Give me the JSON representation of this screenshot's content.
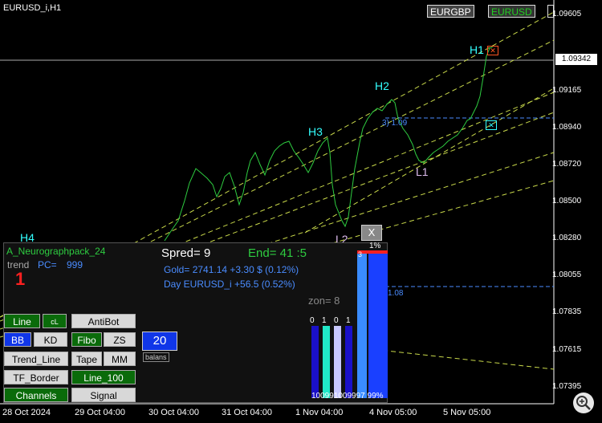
{
  "symbol_title": "EURUSD_i,H1",
  "symbol_tabs": [
    {
      "label": "EURGBP",
      "color": "#ffffff"
    },
    {
      "label": "EURUSD",
      "color": "#22cc22"
    }
  ],
  "price_axis": [
    "1.09605",
    "1.09165",
    "1.08940",
    "1.08720",
    "1.08500",
    "1.08280",
    "1.08055",
    "1.07835",
    "1.07615",
    "1.07395"
  ],
  "current_price": "1.09342",
  "time_axis": [
    "28 Oct 2024",
    "29 Oct 04:00",
    "30 Oct 04:00",
    "31 Oct 04:00",
    "1 Nov 04:00",
    "4 Nov 05:00",
    "5 Nov 05:00"
  ],
  "waves": {
    "h1": "H1",
    "h2": "H2",
    "h3": "H3",
    "h4": "H4",
    "l1": "L1",
    "l2": "L2"
  },
  "level_labels": {
    "upper": "3) 1.09",
    "lower": "1.08"
  },
  "close_x": "X",
  "panel": {
    "name": "A_Neurographpack_24",
    "trend_label": "trend",
    "pc_label": "PC=",
    "pc_value": "999",
    "trend_number": "1",
    "spread": "Spred= 9",
    "end": "End= 41 :5",
    "gold": "Gold= 2741.14 +3.30 $ (0.12%)",
    "day": "Day EURUSD_i   +56.5 (0.52%)",
    "zone": "zon= 8",
    "balans_value": "20",
    "balans_label": "balans",
    "bars_top": [
      "0",
      "1",
      "0",
      "1"
    ],
    "bars_bottom": "100991009997 99%",
    "right_pct": "1%",
    "right_num": "3"
  },
  "buttons": {
    "line": "Line",
    "cl": "cL",
    "antibot": "AntiBot",
    "bb": "BB",
    "kd": "KD",
    "fibo": "Fibo",
    "zs": "ZS",
    "trend_line": "Trend_Line",
    "tape": "Tape",
    "mm": "MM",
    "tf_border": "TF_Border",
    "line_100": "Line_100",
    "channels": "Channels",
    "signal": "Signal"
  },
  "colors": {
    "price_line": "#2ecc40",
    "guide_line": "#c8d84a",
    "wave_label": "#33ffff",
    "level": "#4a8cff"
  }
}
